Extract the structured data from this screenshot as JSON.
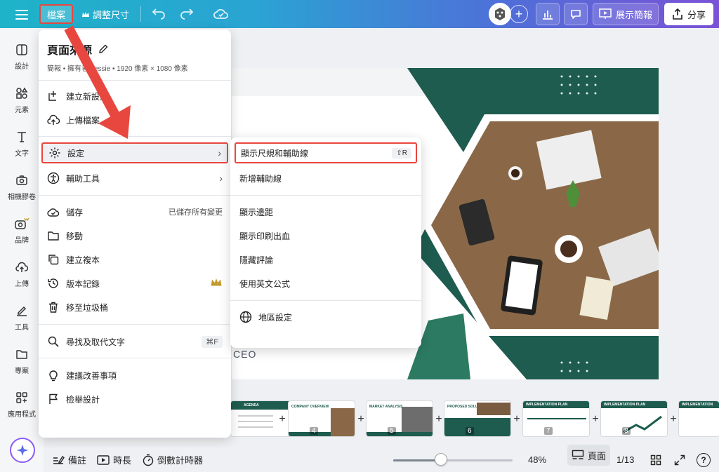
{
  "topbar": {
    "file_label": "檔案",
    "resize_label": "調整尺寸",
    "present_label": "展示簡報",
    "share_label": "分享"
  },
  "sidebar": {
    "items": [
      {
        "label": "設計",
        "icon": "layout-icon"
      },
      {
        "label": "元素",
        "icon": "shapes-icon"
      },
      {
        "label": "文字",
        "icon": "text-icon"
      },
      {
        "label": "相機膠卷",
        "icon": "camera-icon"
      },
      {
        "label": "品牌",
        "icon": "brand-icon"
      },
      {
        "label": "上傳",
        "icon": "upload-icon"
      },
      {
        "label": "工具",
        "icon": "draw-icon"
      },
      {
        "label": "專案",
        "icon": "folder-icon"
      },
      {
        "label": "應用程式",
        "icon": "apps-icon"
      }
    ]
  },
  "file_menu": {
    "title": "頁面來源",
    "subtitle": "簡報 • 擁有者 Jessie • 1920 像素 × 1080 像素",
    "items": [
      {
        "label": "建立新設計"
      },
      {
        "label": "上傳檔案"
      },
      {
        "label": "設定"
      },
      {
        "label": "輔助工具"
      },
      {
        "label": "儲存",
        "right": "已儲存所有變更"
      },
      {
        "label": "移動"
      },
      {
        "label": "建立複本"
      },
      {
        "label": "版本記錄"
      },
      {
        "label": "移至垃圾桶"
      },
      {
        "label": "尋找及取代文字",
        "shortcut": "⌘F"
      },
      {
        "label": "建議改善事項"
      },
      {
        "label": "檢舉設計"
      }
    ]
  },
  "settings_submenu": {
    "items": [
      {
        "label": "顯示尺規和輔助線",
        "shortcut": "⇧R"
      },
      {
        "label": "新增輔助線"
      },
      {
        "label": "顯示邊距"
      },
      {
        "label": "顯示印刷出血"
      },
      {
        "label": "隱藏評論"
      },
      {
        "label": "使用英文公式"
      },
      {
        "label": "地區設定"
      }
    ]
  },
  "slide": {
    "ceo_text": "CEO"
  },
  "thumbnails": [
    {
      "title": "AGENDA",
      "number": ""
    },
    {
      "title": "COMPANY OVERVIEW",
      "number": "4"
    },
    {
      "title": "MARKET ANALYSIS",
      "number": "5"
    },
    {
      "title": "PROPOSED SOLUTION",
      "number": "6"
    },
    {
      "title": "IMPLEMENTATION PLAN",
      "number": "7"
    },
    {
      "title": "IMPLEMENTATION PLAN",
      "number": "8"
    },
    {
      "title": "IMPLEMENTATION",
      "number": ""
    }
  ],
  "bottombar": {
    "notes_label": "備註",
    "duration_label": "時長",
    "timer_label": "倒數計時器",
    "zoom_percent": "48%",
    "zoom_fraction": 0.4,
    "page_view_label": "頁面",
    "page_counter": "1/13",
    "help_label": "?"
  },
  "colors": {
    "accent_red": "#e8473f",
    "slide_green": "#1d5c4f"
  }
}
